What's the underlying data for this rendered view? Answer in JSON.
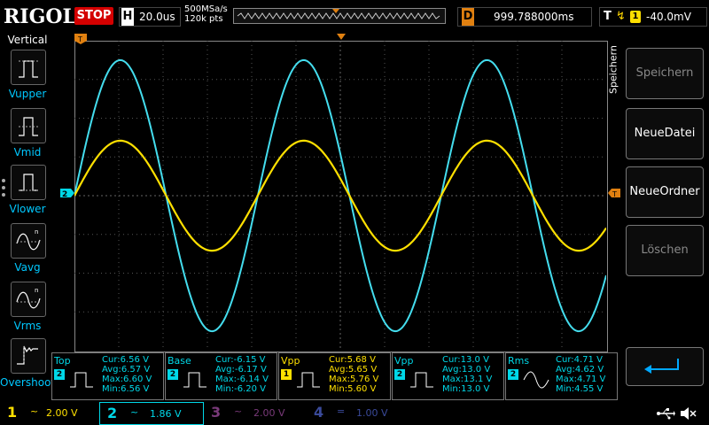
{
  "header": {
    "brand": "RIGOL",
    "run_status": "STOP",
    "horizontal_label": "H",
    "timebase": "20.0us",
    "sample_rate": "500MSa/s",
    "mem_depth": "120k pts",
    "delay_label": "D",
    "delay_value": "999.788000ms",
    "trigger_label": "T",
    "trigger_edge_icon": "rising-edge-icon",
    "trigger_source": "1",
    "trigger_level": "-40.0mV"
  },
  "left_panel": {
    "title": "Vertical",
    "items": [
      {
        "label": "Vupper",
        "icon": "vupper-icon"
      },
      {
        "label": "Vmid",
        "icon": "vmid-icon"
      },
      {
        "label": "Vlower",
        "icon": "vlower-icon"
      },
      {
        "label": "Vavg",
        "icon": "vavg-icon"
      },
      {
        "label": "Vrms",
        "icon": "vrms-icon"
      },
      {
        "label": "Overshoot",
        "icon": "overshoot-icon"
      }
    ]
  },
  "right_panel": {
    "title": "Speichern",
    "buttons": [
      {
        "label": "Speichern",
        "enabled": false
      },
      {
        "label": "NeueDatei",
        "enabled": true
      },
      {
        "label": "NeueOrdner",
        "enabled": true
      },
      {
        "label": "Löschen",
        "enabled": false
      }
    ],
    "enter_icon": "enter-icon"
  },
  "markers": {
    "trigger_pos": "T",
    "ch2_marker": "2",
    "trigger_level_marker": "T"
  },
  "measurements": [
    {
      "name": "Top",
      "channel": "2",
      "cur": "Cur:6.56 V",
      "avg": "Avg:6.57 V",
      "max": "Max:6.60 V",
      "min": "Min:6.56 V"
    },
    {
      "name": "Base",
      "channel": "2",
      "cur": "Cur:-6.15 V",
      "avg": "Avg:-6.17 V",
      "max": "Max:-6.14 V",
      "min": "Min:-6.20 V"
    },
    {
      "name": "Vpp",
      "channel": "1",
      "cur": "Cur:5.68 V",
      "avg": "Avg:5.65 V",
      "max": "Max:5.76 V",
      "min": "Min:5.60 V"
    },
    {
      "name": "Vpp",
      "channel": "2",
      "cur": "Cur:13.0 V",
      "avg": "Avg:13.0 V",
      "max": "Max:13.1 V",
      "min": "Min:13.0 V"
    },
    {
      "name": "Rms",
      "channel": "2",
      "cur": "Cur:4.71 V",
      "avg": "Avg:4.62 V",
      "max": "Max:4.71 V",
      "min": "Min:4.55 V"
    }
  ],
  "channels": [
    {
      "num": "1",
      "coupling": "~",
      "scale": "2.00 V",
      "color": "#ffe000",
      "active": true
    },
    {
      "num": "2",
      "coupling": "~",
      "scale": "1.86 V",
      "color": "#00d8e8",
      "active": true
    },
    {
      "num": "3",
      "coupling": "~",
      "scale": "2.00 V",
      "color": "#7a3a7a",
      "active": false
    },
    {
      "num": "4",
      "coupling": "=",
      "scale": "1.00 V",
      "color": "#3a4a9a",
      "active": false
    }
  ],
  "status_icons": [
    "usb-icon",
    "speaker-muted-icon"
  ],
  "waveforms": {
    "ch1": {
      "color": "#ffe000",
      "amplitude_div": 1.42,
      "periods_on_screen": 2.9,
      "phase_deg": 0
    },
    "ch2": {
      "color": "#44ddee",
      "amplitude_div": 3.5,
      "periods_on_screen": 2.9,
      "phase_deg": 0
    }
  }
}
